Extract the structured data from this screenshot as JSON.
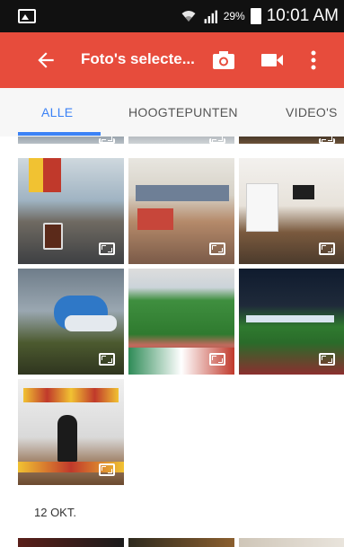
{
  "status_bar": {
    "battery_percent": "29%",
    "time": "10:01 AM",
    "icons": [
      "image-icon",
      "wifi-icon",
      "signal-icon",
      "battery-icon"
    ]
  },
  "app_bar": {
    "title": "Foto's selecte...",
    "back_icon": "arrow-left-icon",
    "actions": [
      "camera-icon",
      "video-camera-icon",
      "more-vert-icon"
    ],
    "color": "#e74c3c"
  },
  "tabs": {
    "items": [
      {
        "label": "ALLE",
        "active": true
      },
      {
        "label": "HOOGTEPUNTEN",
        "active": false
      },
      {
        "label": "VIDEO'S",
        "active": false
      }
    ],
    "accent": "#3b82f6"
  },
  "gallery": {
    "section_date": "12 OKT.",
    "thumbnail_icon": "expand-icon"
  }
}
